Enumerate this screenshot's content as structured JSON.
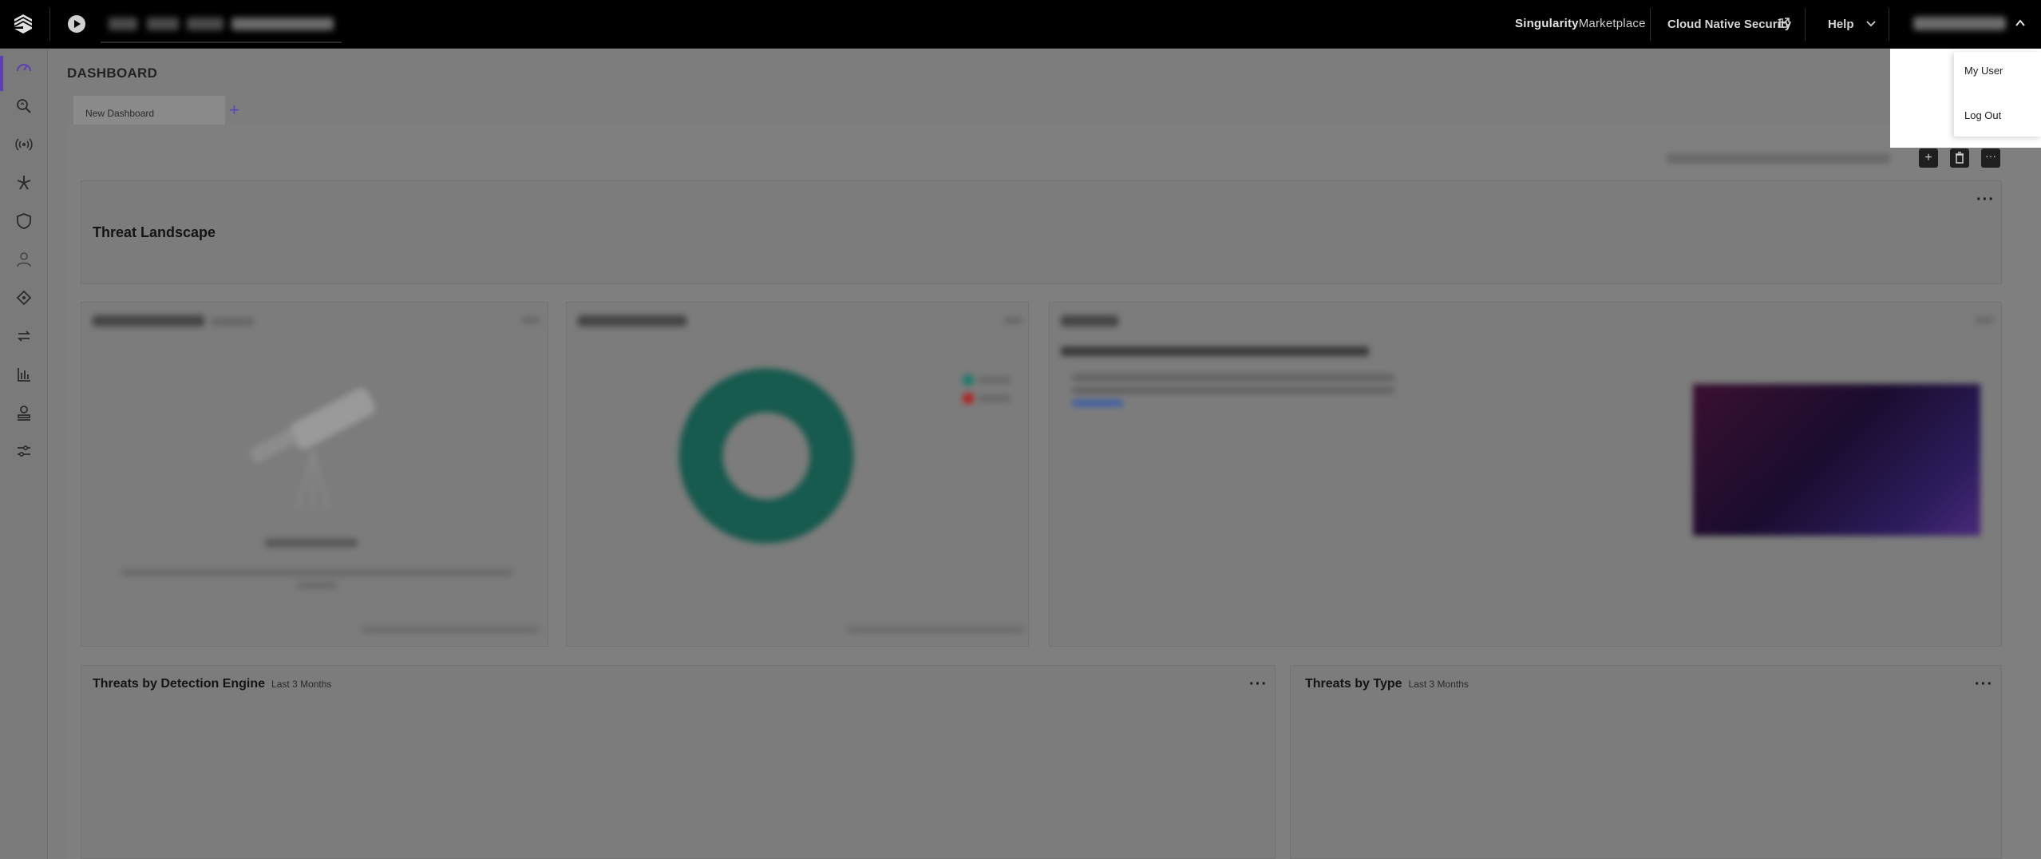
{
  "topbar": {
    "marketplace_prefix": "Singularity",
    "marketplace_suffix": "Marketplace",
    "cloud_native_security": "Cloud Native Security",
    "help": "Help"
  },
  "sidebar": {
    "items": [
      {
        "icon": "dashboard-gauge-icon"
      },
      {
        "icon": "search-icon"
      },
      {
        "icon": "broadcast-icon"
      },
      {
        "icon": "star-burst-icon"
      },
      {
        "icon": "shield-icon"
      },
      {
        "icon": "user-icon"
      },
      {
        "icon": "diamond-tag-icon"
      },
      {
        "icon": "sync-icon"
      },
      {
        "icon": "bar-chart-icon"
      },
      {
        "icon": "stamp-icon"
      },
      {
        "icon": "sliders-icon"
      }
    ]
  },
  "page": {
    "title": "DASHBOARD",
    "tab_label": "New Dashboard",
    "add_tab": "+"
  },
  "cards": {
    "threat_landscape": {
      "title": "Threat Landscape"
    },
    "detection_engine": {
      "title": "Threats by Detection Engine",
      "subtitle": "Last 3 Months"
    },
    "threats_by_type": {
      "title": "Threats by Type",
      "subtitle": "Last 3 Months"
    }
  },
  "user_menu": {
    "items": [
      "My User",
      "Log Out"
    ]
  },
  "colors": {
    "accent": "#5d3fb3",
    "donut": "#175a4e",
    "legend_green": "#1a7a69",
    "legend_red": "#b0201d"
  }
}
